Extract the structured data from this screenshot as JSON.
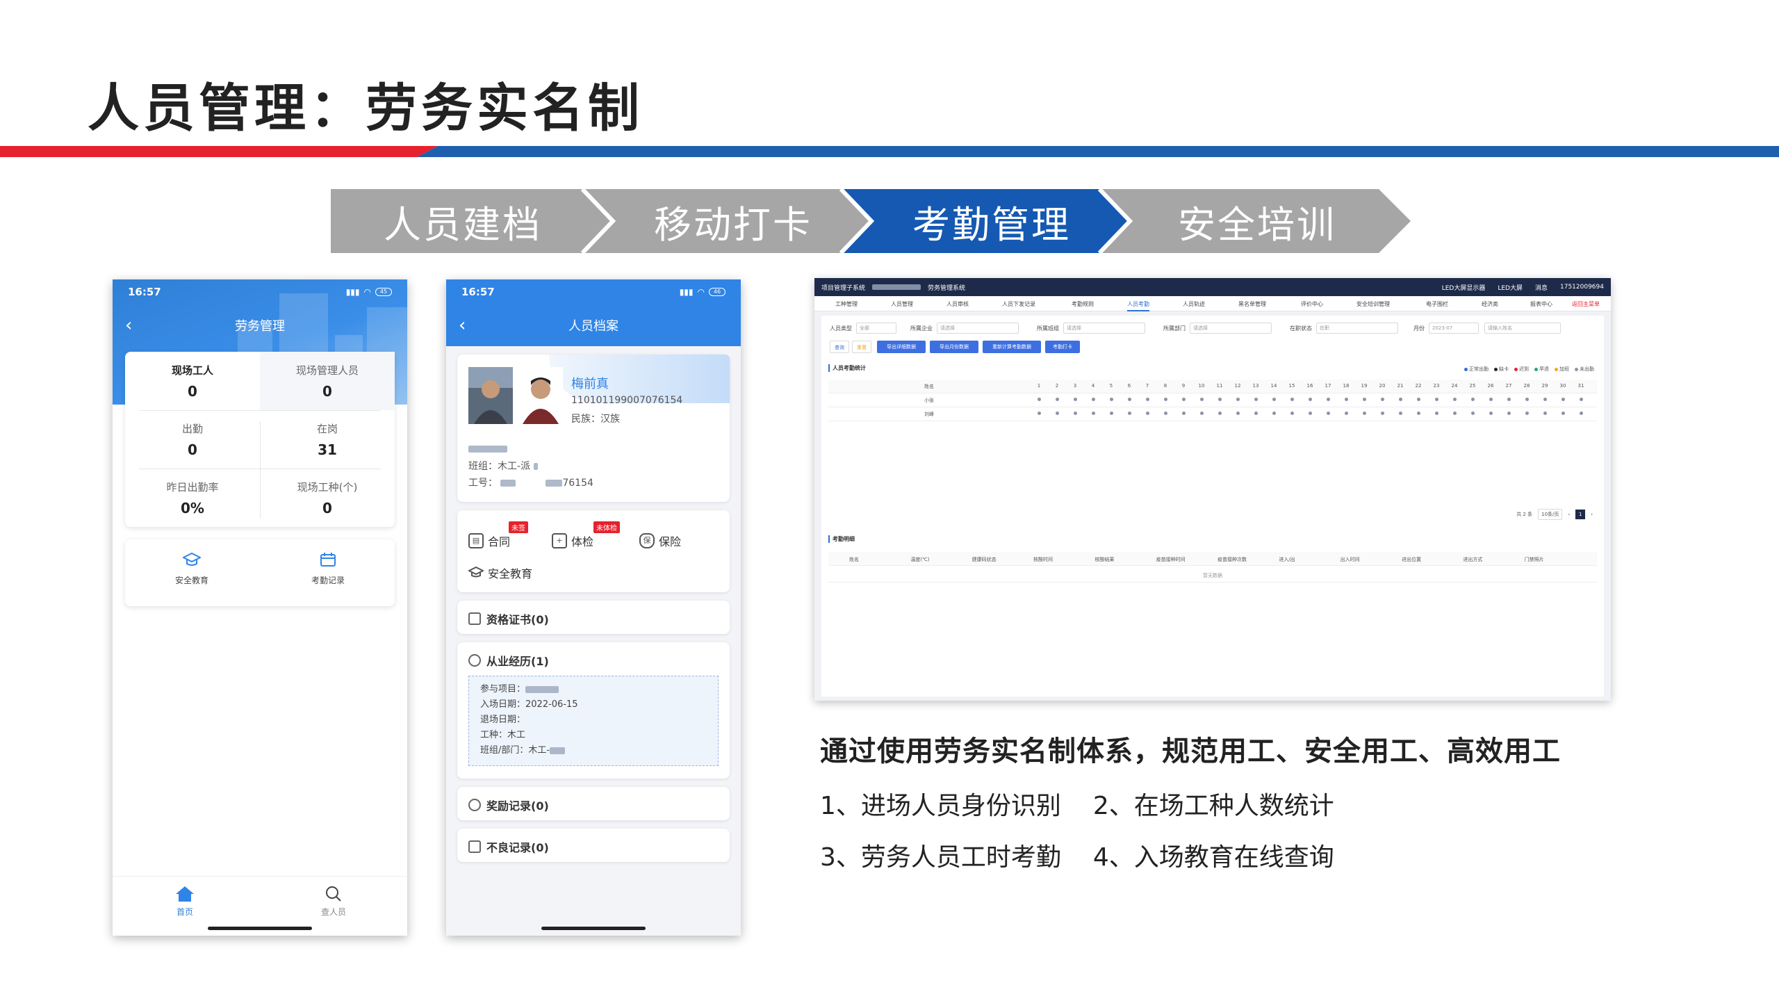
{
  "slide": {
    "title": "人员管理：劳务实名制",
    "colors": {
      "red": "#e5222d",
      "blue": "#1f5fb0",
      "gray": "#a6a6a6",
      "active_step": "#1559b2"
    }
  },
  "steps": [
    {
      "label": "人员建档",
      "active": false
    },
    {
      "label": "移动打卡",
      "active": false
    },
    {
      "label": "考勤管理",
      "active": true
    },
    {
      "label": "安全培训",
      "active": false
    }
  ],
  "phone1": {
    "time": "16:57",
    "title": "劳务管理",
    "battery": "45",
    "stats": [
      {
        "label": "现场工人",
        "value": "0"
      },
      {
        "label": "现场管理人员",
        "value": "0"
      },
      {
        "label": "出勤",
        "value": "0"
      },
      {
        "label": "在岗",
        "value": "31"
      },
      {
        "label": "昨日出勤率",
        "value": "0%"
      },
      {
        "label": "现场工种(个)",
        "value": "0"
      }
    ],
    "shortcuts": [
      {
        "label": "安全教育",
        "icon": "graduation-cap-icon"
      },
      {
        "label": "考勤记录",
        "icon": "calendar-icon"
      }
    ],
    "tabs": [
      {
        "label": "首页",
        "icon": "home-icon"
      },
      {
        "label": "查人员",
        "icon": "search-icon"
      }
    ]
  },
  "phone2": {
    "time": "16:57",
    "title": "人员档案",
    "battery": "46",
    "profile": {
      "name": "梅前真",
      "id_number": "110101199007076154",
      "ethnicity": "民族：汉族",
      "team_label": "班组：木工-",
      "team_suffix": "派",
      "worker_no_label": "工号：",
      "worker_no_suffix": "76154"
    },
    "actions": [
      {
        "label": "合同",
        "tag": "未签"
      },
      {
        "label": "体检",
        "tag": "未体检"
      },
      {
        "label": "保险",
        "tag": ""
      },
      {
        "label": "安全教育",
        "tag": ""
      }
    ],
    "sections": {
      "certificates": "资格证书(0)",
      "experience": "从业经历(1)",
      "rewards": "奖励记录(0)",
      "bad_records": "不良记录(0)"
    },
    "experience": {
      "project_label": "参与项目：",
      "entry_date": "入场日期：2022-06-15",
      "exit_date": "退场日期：",
      "trade": "工种：木工",
      "team_label": "班组/部门：木工-"
    }
  },
  "desktop": {
    "system_title": "项目管理子系统",
    "system_suffix": "劳务管理系统",
    "top_right": [
      "LED大屏显示器",
      "LED大屏",
      "消息",
      "17512009694"
    ],
    "nav": [
      "工种管理",
      "人员管理",
      "人员审核",
      "人员下发记录",
      "考勤规则",
      "人员考勤",
      "人员轨迹",
      "黑名单管理",
      "评价中心",
      "安全培训管理",
      "电子围栏",
      "经济类",
      "报表中心",
      "返回主菜单"
    ],
    "filters": {
      "person_type_label": "人员类型",
      "person_type_value": "全部",
      "company_label": "所属企业",
      "company_value": "请选择",
      "team_label": "所属班组",
      "team_value": "请选择",
      "dept_label": "所属部门",
      "dept_value": "请选择",
      "status_label": "在职状态",
      "status_value": "在职",
      "month_label": "月份",
      "month_value": "2023-07",
      "name_placeholder": "请输入姓名"
    },
    "buttons": [
      {
        "label": "查询",
        "color": "#ffffff"
      },
      {
        "label": "重置",
        "color": "#ffffff"
      },
      {
        "label": "导出详细数据",
        "color": "#3d6fe0"
      },
      {
        "label": "导出月份数据",
        "color": "#3d6fe0"
      },
      {
        "label": "重新计算考勤数据",
        "color": "#3d6fe0"
      },
      {
        "label": "考勤打卡",
        "color": "#3d6fe0"
      }
    ],
    "stats_section": "人员考勤统计",
    "legend": [
      "正常出勤",
      "缺卡",
      "迟到",
      "早退",
      "加班",
      "未出勤"
    ],
    "legend_colors": [
      "#2f6fd6",
      "#222222",
      "#e5222d",
      "#23a86b",
      "#f5a623",
      "#8a94a6"
    ],
    "name_header": "姓名",
    "days": [
      "1",
      "2",
      "3",
      "4",
      "5",
      "6",
      "7",
      "8",
      "9",
      "10",
      "11",
      "12",
      "13",
      "14",
      "15",
      "16",
      "17",
      "18",
      "19",
      "20",
      "21",
      "22",
      "23",
      "24",
      "25",
      "26",
      "27",
      "28",
      "29",
      "30",
      "31"
    ],
    "rows": [
      "小张",
      "刘峰"
    ],
    "pager": {
      "total": "共 2 条",
      "page_size": "10条/页",
      "current": "1"
    },
    "detail_section": "考勤明细",
    "detail_headers": [
      "姓名",
      "温度(℃)",
      "健康码状态",
      "核酸时间",
      "核酸结果",
      "疫苗接种时间",
      "疫苗接种次数",
      "进入/出",
      "出入时间",
      "进出位置",
      "进出方式",
      "门禁照片"
    ],
    "no_data": "暂无数据"
  },
  "summary": "通过使用劳务实名制体系，规范用工、安全用工、高效用工",
  "points": [
    [
      "1、进场人员身份识别",
      "2、在场工种人数统计"
    ],
    [
      "3、劳务人员工时考勤",
      "4、入场教育在线查询"
    ]
  ]
}
